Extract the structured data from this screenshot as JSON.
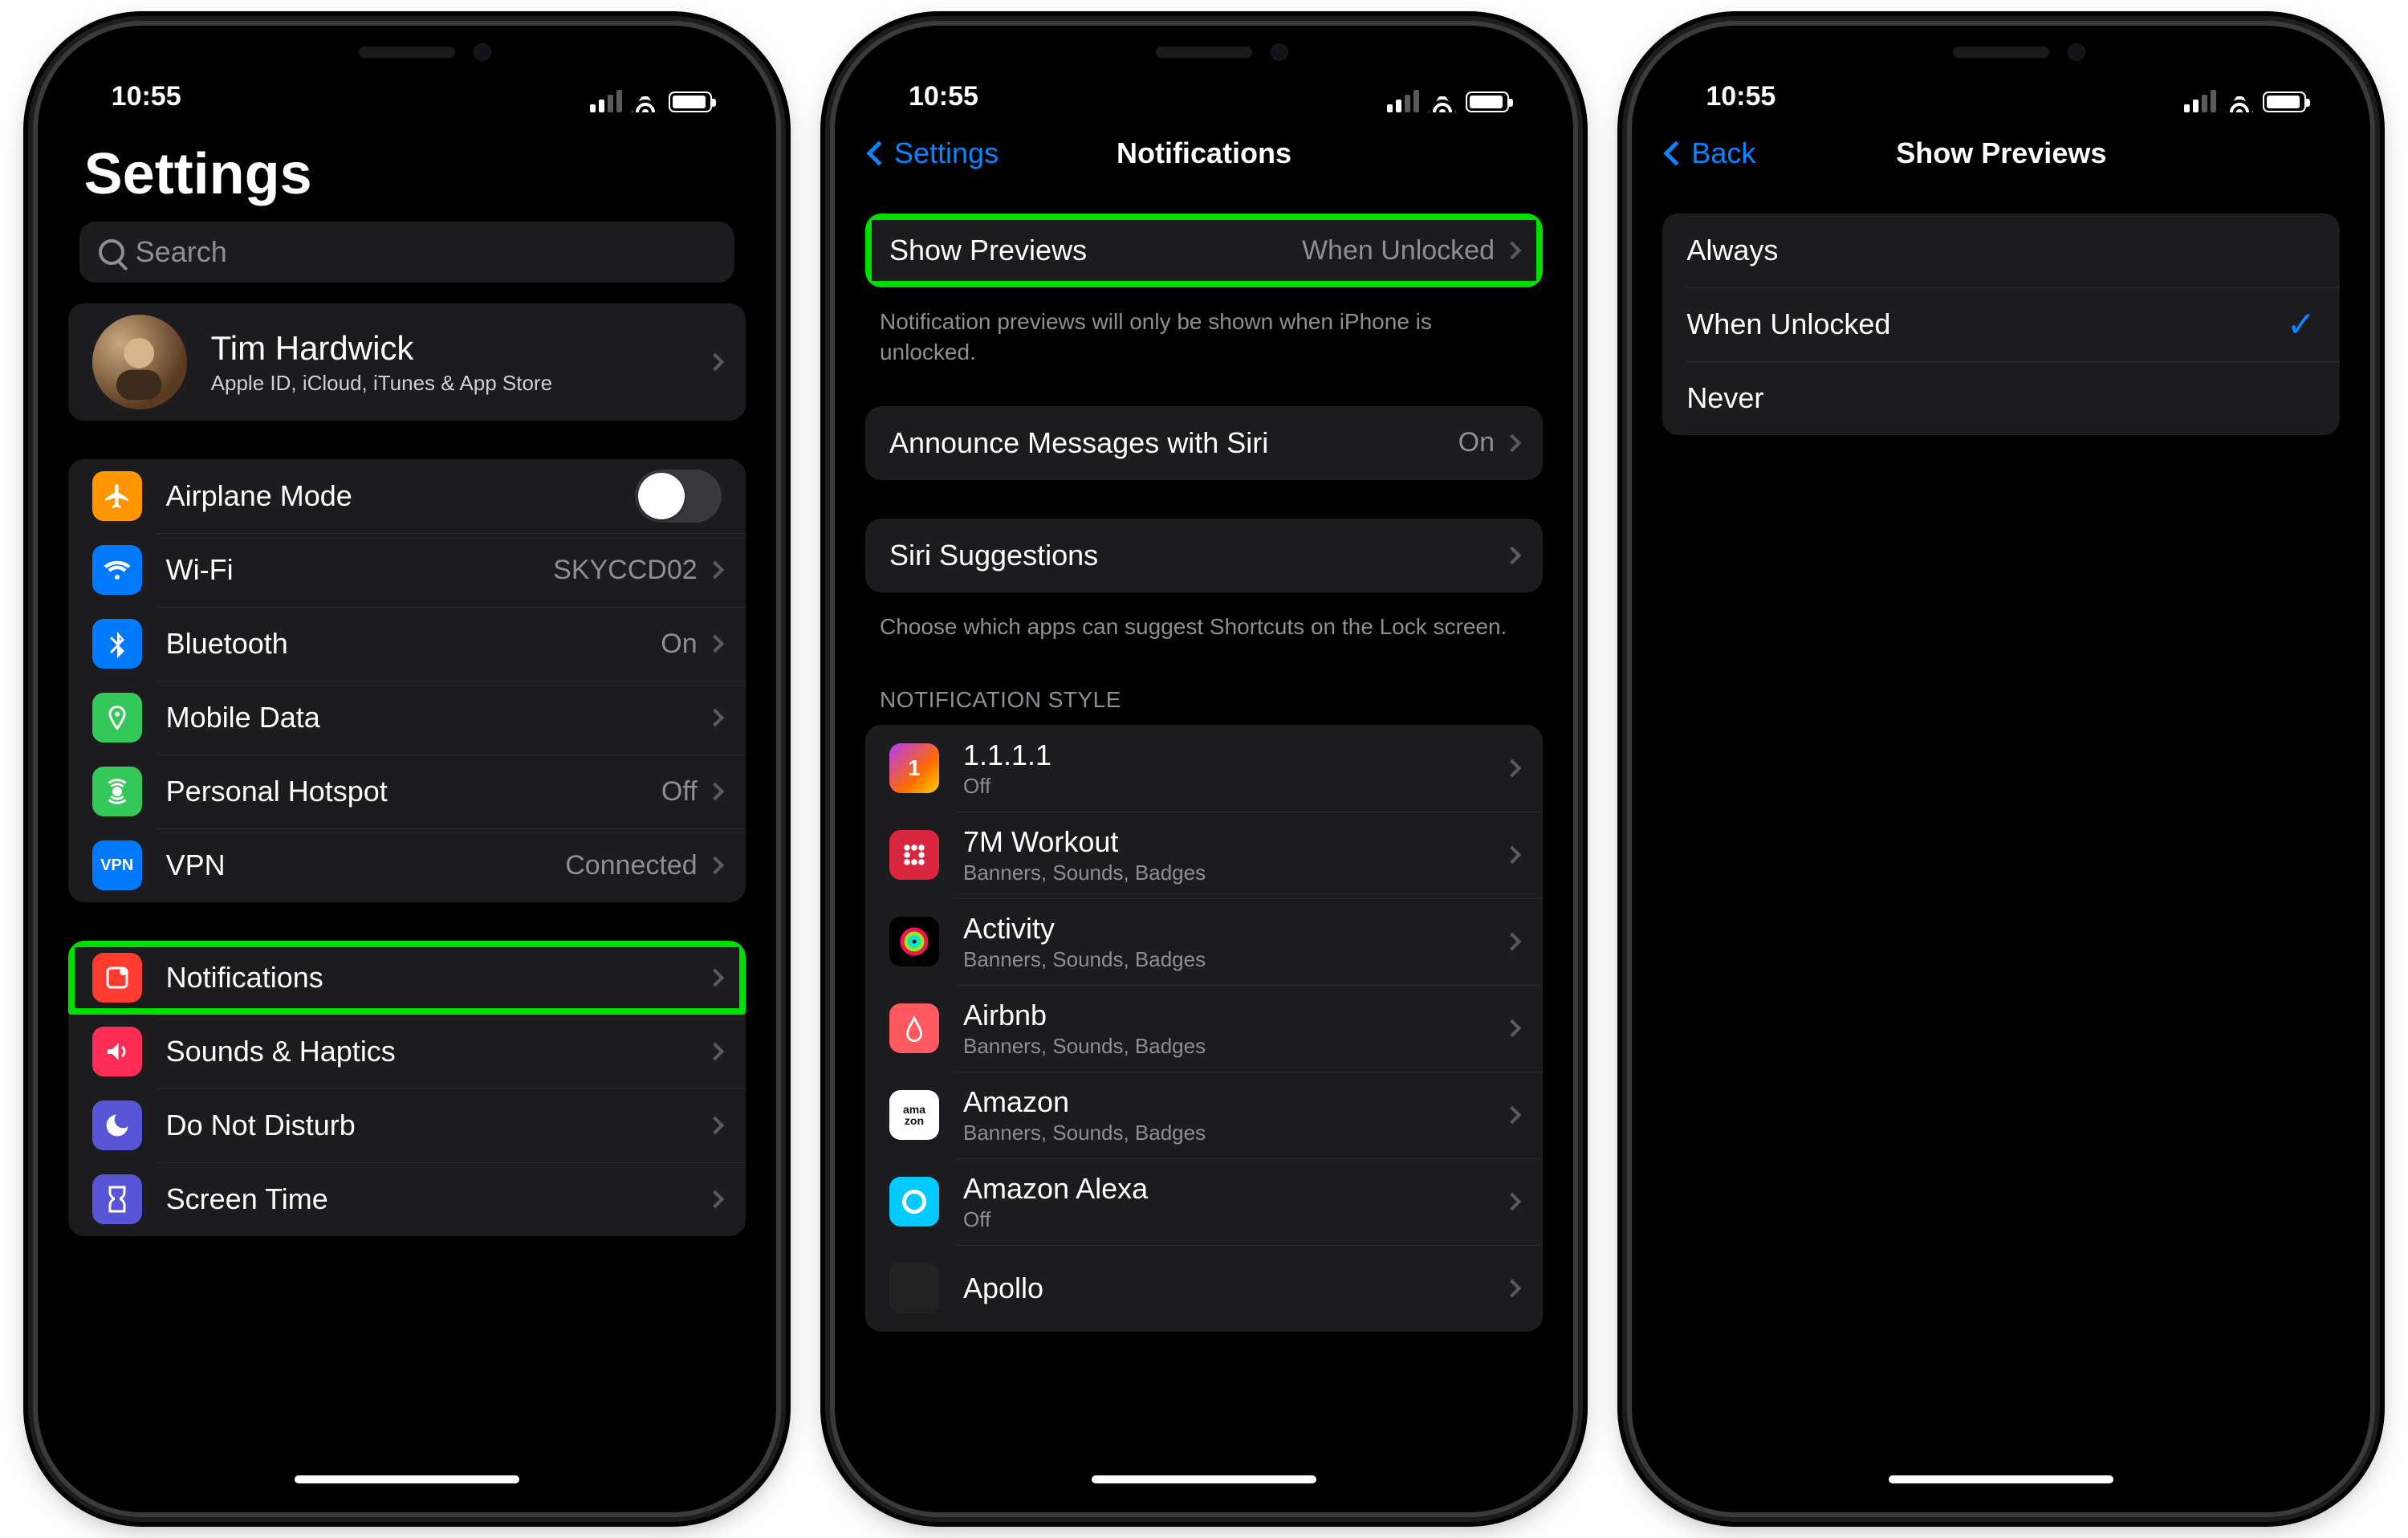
{
  "status": {
    "time": "10:55"
  },
  "screen1": {
    "title": "Settings",
    "searchPlaceholder": "Search",
    "appleId": {
      "name": "Tim Hardwick",
      "subtitle": "Apple ID, iCloud, iTunes & App Store"
    },
    "group1": [
      {
        "id": "airplane",
        "label": "Airplane Mode",
        "kind": "toggle",
        "color": "#ff9500"
      },
      {
        "id": "wifi",
        "label": "Wi-Fi",
        "value": "SKYCCD02",
        "color": "#007aff"
      },
      {
        "id": "bluetooth",
        "label": "Bluetooth",
        "value": "On",
        "color": "#007aff"
      },
      {
        "id": "mobiledata",
        "label": "Mobile Data",
        "color": "#34c759"
      },
      {
        "id": "hotspot",
        "label": "Personal Hotspot",
        "value": "Off",
        "color": "#34c759"
      },
      {
        "id": "vpn",
        "label": "VPN",
        "value": "Connected",
        "color": "#007aff",
        "badge": "VPN"
      }
    ],
    "group2": [
      {
        "id": "notifications",
        "label": "Notifications",
        "color": "#ff3b30",
        "highlight": true
      },
      {
        "id": "sounds",
        "label": "Sounds & Haptics",
        "color": "#ff2d55"
      },
      {
        "id": "dnd",
        "label": "Do Not Disturb",
        "color": "#5856d6"
      },
      {
        "id": "screentime",
        "label": "Screen Time",
        "color": "#5856d6"
      }
    ]
  },
  "screen2": {
    "back": "Settings",
    "title": "Notifications",
    "previews": {
      "label": "Show Previews",
      "value": "When Unlocked",
      "highlight": true
    },
    "previewsFooter": "Notification previews will only be shown when iPhone is unlocked.",
    "announce": {
      "label": "Announce Messages with Siri",
      "value": "On"
    },
    "siri": {
      "label": "Siri Suggestions"
    },
    "siriFooter": "Choose which apps can suggest Shortcuts on the Lock screen.",
    "styleHeader": "NOTIFICATION STYLE",
    "apps": [
      {
        "name": "1.1.1.1",
        "sub": "Off",
        "color": "linear-gradient(135deg,#b13cff,#ff6a00 60%,#ffd200)"
      },
      {
        "name": "7M Workout",
        "sub": "Banners, Sounds, Badges",
        "color": "#d7263d"
      },
      {
        "name": "Activity",
        "sub": "Banners, Sounds, Badges",
        "color": "#000"
      },
      {
        "name": "Airbnb",
        "sub": "Banners, Sounds, Badges",
        "color": "#ff5a5f"
      },
      {
        "name": "Amazon",
        "sub": "Banners, Sounds, Badges",
        "color": "#fff"
      },
      {
        "name": "Amazon Alexa",
        "sub": "Off",
        "color": "#00caff"
      },
      {
        "name": "Apollo",
        "sub": "",
        "color": "#222"
      }
    ]
  },
  "screen3": {
    "back": "Back",
    "title": "Show Previews",
    "options": [
      {
        "label": "Always",
        "selected": false
      },
      {
        "label": "When Unlocked",
        "selected": true
      },
      {
        "label": "Never",
        "selected": false
      }
    ]
  }
}
